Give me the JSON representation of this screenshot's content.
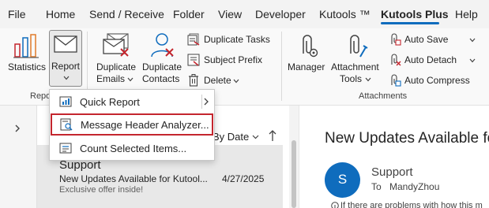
{
  "menu": {
    "tabs": [
      {
        "label": "File"
      },
      {
        "label": "Home"
      },
      {
        "label": "Send / Receive"
      },
      {
        "label": "Folder"
      },
      {
        "label": "View"
      },
      {
        "label": "Developer"
      },
      {
        "label": "Kutools ™"
      },
      {
        "label": "Kutools Plus",
        "active": true
      },
      {
        "label": "Help"
      }
    ]
  },
  "ribbon": {
    "statistics_label": "Statistics",
    "report_label": "Report",
    "duplicate_emails_line1": "Duplicate",
    "duplicate_emails_line2": "Emails",
    "duplicate_contacts_line1": "Duplicate",
    "duplicate_contacts_line2": "Contacts",
    "duplicate_tasks_label": "Duplicate Tasks",
    "subject_prefix_label": "Subject Prefix",
    "delete_label": "Delete",
    "manager_label": "Manager",
    "attachment_tools_line1": "Attachment",
    "attachment_tools_line2": "Tools",
    "auto_save_label": "Auto Save",
    "auto_detach_label": "Auto Detach",
    "auto_compress_label": "Auto Compress",
    "group_report_partial": "Repo",
    "group_attachments": "Attachments"
  },
  "dropdown": {
    "items": [
      {
        "label": "Quick Report",
        "has_submenu": true
      },
      {
        "label": "Message Header Analyzer...",
        "highlighted": true
      },
      {
        "label": "Count Selected Items..."
      }
    ]
  },
  "maillist": {
    "sort_label": "By Date",
    "item": {
      "sender": "Support",
      "subject": "New Updates Available for Kutool...",
      "date": "4/27/2025",
      "preview": "Exclusive offer inside!"
    }
  },
  "reading": {
    "title": "New Updates Available fo",
    "avatar_letter": "S",
    "sender": "Support",
    "to_label": "To",
    "recipient": "MandyZhou",
    "info_partial": "If there are problems with how this m"
  },
  "colors": {
    "accent": "#0f6cbd",
    "highlight_border": "#c4262e",
    "avatar": "#0f6cbd"
  }
}
